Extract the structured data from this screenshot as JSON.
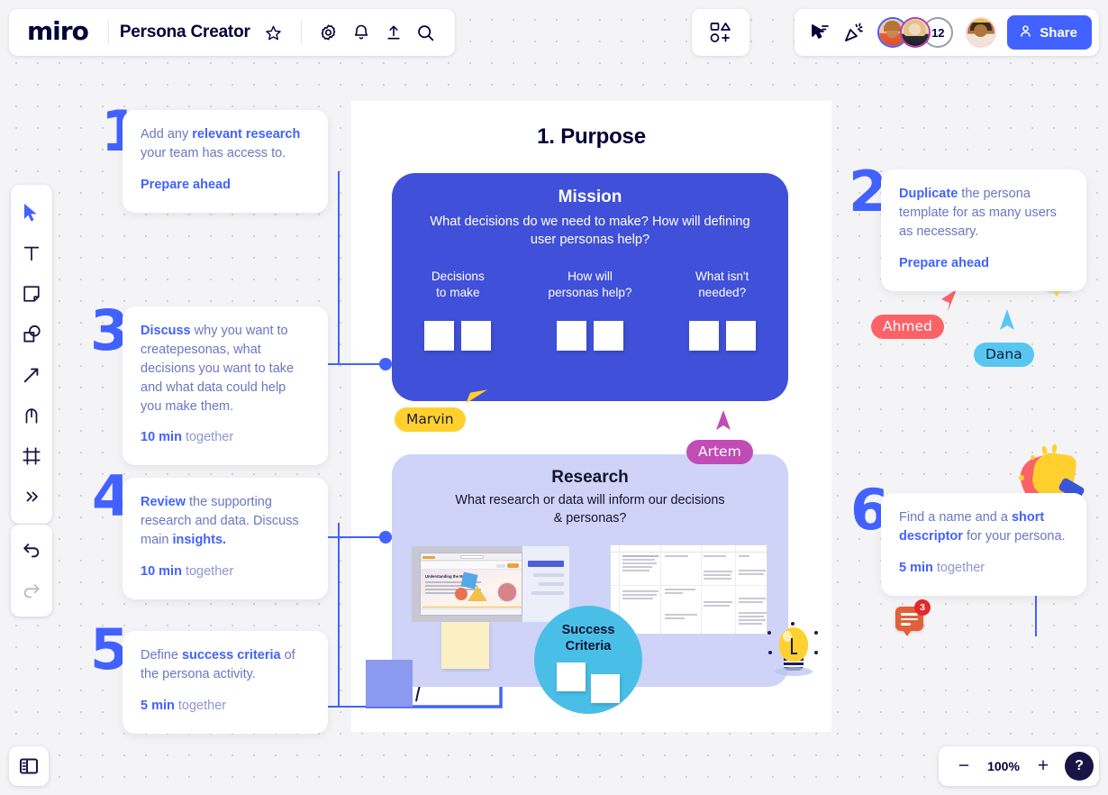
{
  "app": {
    "name": "miro",
    "board_title": "Persona Creator"
  },
  "topbar": {
    "icons": [
      {
        "name": "star-icon",
        "label": "Favorite"
      },
      {
        "name": "gear-icon",
        "label": "Settings"
      },
      {
        "name": "bell-icon",
        "label": "Notifications"
      },
      {
        "name": "upload-icon",
        "label": "Upload"
      },
      {
        "name": "search-icon",
        "label": "Search"
      }
    ],
    "apps_label": "Apps and integrations",
    "cursor_tool_label": "Collaborator cursors",
    "celebrate_label": "Celebrate",
    "collaborator_count": "12",
    "share_label": "Share"
  },
  "left_toolbar": {
    "tools": [
      {
        "name": "select-tool",
        "label": "Select"
      },
      {
        "name": "text-tool",
        "label": "Text"
      },
      {
        "name": "sticky-note-tool",
        "label": "Sticky note"
      },
      {
        "name": "shapes-tool",
        "label": "Shapes"
      },
      {
        "name": "connection-line-tool",
        "label": "Connection line"
      },
      {
        "name": "pen-tool",
        "label": "Pen"
      },
      {
        "name": "frame-tool",
        "label": "Frame"
      },
      {
        "name": "more-tools",
        "label": "More tools"
      }
    ],
    "undo_label": "Undo",
    "redo_label": "Redo"
  },
  "bottom_bar": {
    "panel_toggle_label": "Toggle side panel",
    "zoom_out_label": "−",
    "zoom_level": "100%",
    "zoom_in_label": "+",
    "help_label": "?"
  },
  "frame": {
    "title": "1. Purpose"
  },
  "mission": {
    "heading": "Mission",
    "question": "What decisions do we need to make? How will defining user personas help?",
    "columns": [
      {
        "label": "Decisions\nto make",
        "notes": 2
      },
      {
        "label": "How will\npersonas help?",
        "notes": 2
      },
      {
        "label": "What isn't\nneeded?",
        "notes": 2
      }
    ]
  },
  "research": {
    "heading": "Research",
    "question": "What research or data will inform our decisions & personas?",
    "screenshot_title": "Understanding the Market",
    "success_circle": {
      "line1": "Success",
      "line2": "Criteria",
      "notes": 2
    }
  },
  "steps": [
    {
      "number": "1",
      "side": "left",
      "text_parts": [
        {
          "t": "Add any ",
          "b": false
        },
        {
          "t": "relevant research",
          "b": true
        },
        {
          "t": " your team has access to.",
          "b": false
        }
      ],
      "lead": "Prepare ahead",
      "duration": null
    },
    {
      "number": "2",
      "side": "right",
      "text_parts": [
        {
          "t": "Duplicate",
          "b": true
        },
        {
          "t": " the persona template for as many users as necessary.",
          "b": false
        }
      ],
      "lead": "Prepare ahead",
      "duration": null
    },
    {
      "number": "3",
      "side": "left",
      "text_parts": [
        {
          "t": "Discuss",
          "b": true
        },
        {
          "t": " why you want to createpesonas, what decisions you want to take and what data could help you make them.",
          "b": false
        }
      ],
      "lead": null,
      "duration": {
        "bold": "10 min",
        "rest": " together"
      }
    },
    {
      "number": "4",
      "side": "left",
      "text_parts": [
        {
          "t": "Review",
          "b": true
        },
        {
          "t": " the supporting research and data. Discuss main ",
          "b": false
        },
        {
          "t": "insights.",
          "b": true
        }
      ],
      "lead": null,
      "duration": {
        "bold": "10 min",
        "rest": " together"
      }
    },
    {
      "number": "5",
      "side": "left",
      "text_parts": [
        {
          "t": "Define ",
          "b": false
        },
        {
          "t": "success criteria",
          "b": true
        },
        {
          "t": " of the persona activity.",
          "b": false
        }
      ],
      "lead": null,
      "duration": {
        "bold": "5 min",
        "rest": " together"
      }
    },
    {
      "number": "6",
      "side": "right",
      "text_parts": [
        {
          "t": "Find a name and a ",
          "b": false
        },
        {
          "t": "short descriptor",
          "b": true
        },
        {
          "t": " for your persona.",
          "b": false
        }
      ],
      "lead": null,
      "duration": {
        "bold": "5 min",
        "rest": " together"
      }
    }
  ],
  "cursors": [
    {
      "name": "Marvin",
      "color": "#ffd02e",
      "text_color": "#1b1b3a"
    },
    {
      "name": "Artem",
      "color": "#c14cb5",
      "text_color": "#ffffff"
    },
    {
      "name": "Ahmed",
      "color": "#fb6268",
      "text_color": "#ffffff"
    },
    {
      "name": "Dana",
      "color": "#57c7f2",
      "text_color": "#1b1b3a"
    }
  ],
  "comments": [
    {
      "id": "comment-yellow",
      "count": "3",
      "color": "#f7d747"
    },
    {
      "id": "comment-orange",
      "count": "3",
      "color": "#e1603a"
    }
  ],
  "decorations": [
    {
      "name": "clapping-hands-emoji"
    },
    {
      "name": "lightbulb-emoji"
    }
  ],
  "colors": {
    "accent": "#4262ff",
    "mission_bg": "#4050d8",
    "research_bg": "#cfd3f7",
    "success_bg": "#49bfe8",
    "canvas_bg": "#f4f4f6"
  }
}
